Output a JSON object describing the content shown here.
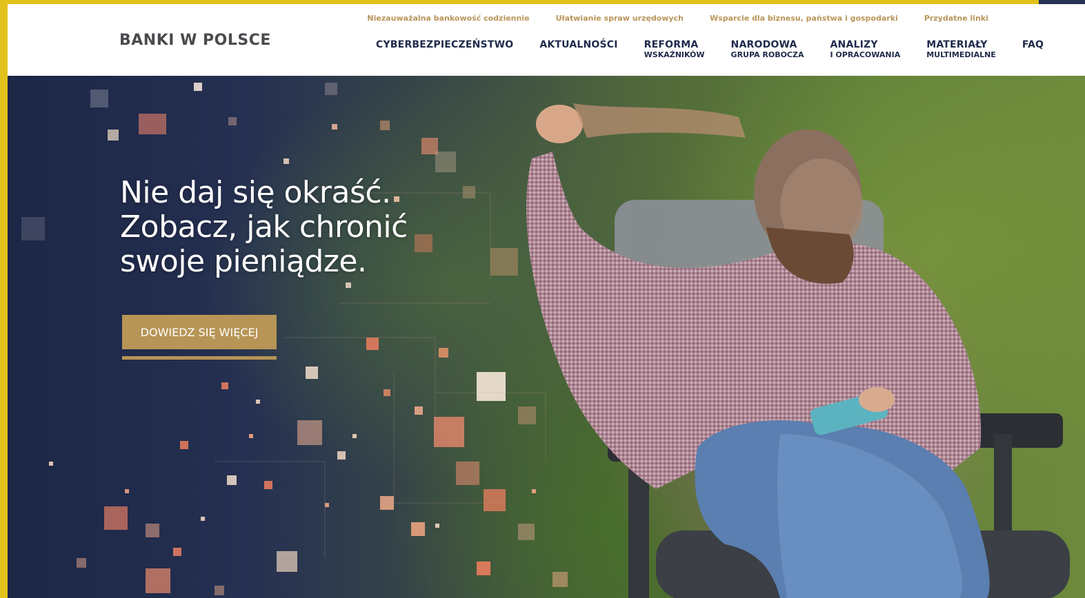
{
  "site": {
    "logo": "BANKI W POLSCE"
  },
  "top_links": [
    "Niezauważalna bankowość codziennie",
    "Ułatwianie spraw urzędowych",
    "Wsparcie dla biznesu, państwa i gospodarki",
    "Przydatne linki"
  ],
  "nav": [
    {
      "l1": "CYBERBEZPIECZEŃSTWO",
      "l2": ""
    },
    {
      "l1": "AKTUALNOŚCI",
      "l2": ""
    },
    {
      "l1": "REFORMA",
      "l2": "WSKAŹNIKÓW"
    },
    {
      "l1": "NARODOWA",
      "l2": "GRUPA ROBOCZA"
    },
    {
      "l1": "ANALIZY",
      "l2": "I OPRACOWANIA"
    },
    {
      "l1": "MATERIAŁY",
      "l2": "MULTIMEDIALNE"
    },
    {
      "l1": "FAQ",
      "l2": ""
    }
  ],
  "hero": {
    "headline": "Nie daj się okraść.\nZobacz, jak chronić\nswoje pieniądze.",
    "cta_label": "DOWIEDZ SIĘ WIĘCEJ"
  },
  "colors": {
    "frame": "#e3c11c",
    "accent_gold": "#b79556",
    "nav_text": "#1f2a4a",
    "logo_text": "#4a4b4f"
  }
}
